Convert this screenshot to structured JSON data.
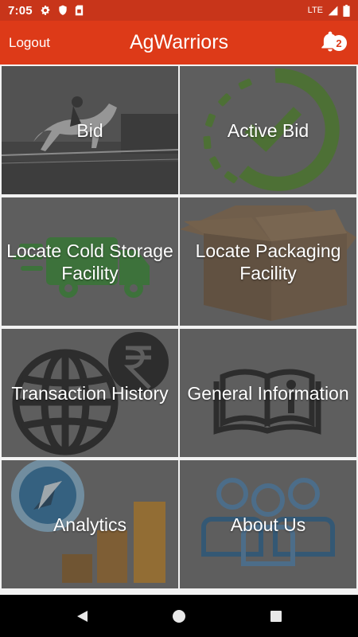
{
  "status_bar": {
    "time": "7:05",
    "network": "LTE",
    "icons": [
      "settings-icon",
      "shield-icon",
      "sim-card-icon",
      "signal-icon",
      "battery-icon"
    ]
  },
  "app_bar": {
    "logout_label": "Logout",
    "title": "AgWarriors",
    "notification_count": "2",
    "notification_icon": "bell-icon"
  },
  "tiles": [
    {
      "label": "Bid"
    },
    {
      "label": "Active Bid"
    },
    {
      "label": "Locate Cold Storage Facility"
    },
    {
      "label": "Locate Packaging Facility"
    },
    {
      "label": "Transaction History"
    },
    {
      "label": "General Information"
    },
    {
      "label": "Analytics"
    },
    {
      "label": "About Us"
    }
  ],
  "nav_bar": {
    "icons": [
      "back-icon",
      "home-icon",
      "recents-icon"
    ]
  },
  "colors": {
    "status_bar": "#c8351a",
    "app_bar": "#dd3a18",
    "tile_overlay": "#5b5b5b",
    "accent_green": "#4c8a1f"
  }
}
